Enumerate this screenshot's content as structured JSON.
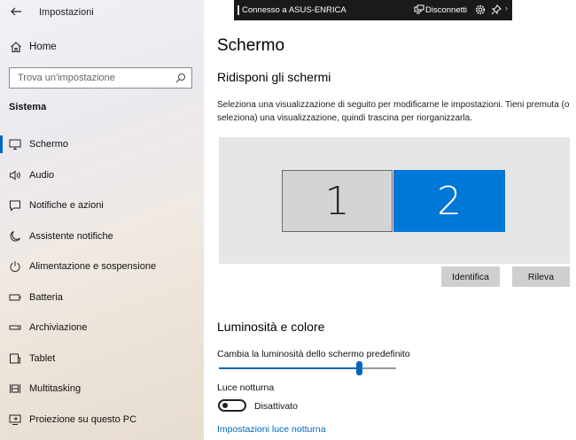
{
  "window": {
    "title": "Impostazioni"
  },
  "sidebar": {
    "home_label": "Home",
    "search_placeholder": "Trova un'impostazione",
    "section_title": "Sistema",
    "items": [
      {
        "label": "Schermo",
        "icon": "monitor-icon",
        "active": true
      },
      {
        "label": "Audio",
        "icon": "speaker-icon"
      },
      {
        "label": "Notifiche e azioni",
        "icon": "message-icon"
      },
      {
        "label": "Assistente notifiche",
        "icon": "moon-icon"
      },
      {
        "label": "Alimentazione e sospensione",
        "icon": "power-icon"
      },
      {
        "label": "Batteria",
        "icon": "battery-icon"
      },
      {
        "label": "Archiviazione",
        "icon": "storage-icon"
      },
      {
        "label": "Tablet",
        "icon": "tablet-icon"
      },
      {
        "label": "Multitasking",
        "icon": "multitasking-icon"
      },
      {
        "label": "Proiezione su questo PC",
        "icon": "projection-icon"
      }
    ]
  },
  "remote_bar": {
    "connection": "Connesso a ASUS-ENRICA",
    "disconnect": "Disconnetti"
  },
  "main": {
    "title": "Schermo",
    "arrange": {
      "heading": "Ridisponi gli schermi",
      "description": "Seleziona una visualizzazione di seguito per modificarne le impostazioni. Tieni premuta (o seleziona) una visualizzazione, quindi trascina per riorganizzarla.",
      "monitors": [
        "1",
        "2"
      ],
      "selected_monitor": "2",
      "identify_label": "Identifica",
      "detect_label": "Rileva"
    },
    "brightness": {
      "heading": "Luminosità e colore",
      "slider_label": "Cambia la luminosità dello schermo predefinito",
      "value_fraction": 0.79,
      "night_light_label": "Luce notturna",
      "night_light_state": "Disattivato",
      "night_light_link": "Impostazioni luce notturna"
    }
  },
  "colors": {
    "accent": "#0067c0",
    "selected_monitor": "#0078d7"
  }
}
